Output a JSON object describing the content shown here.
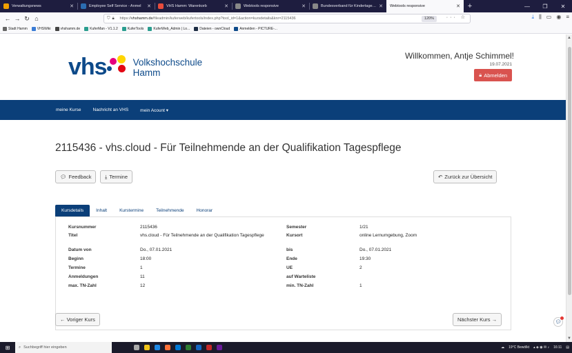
{
  "browser": {
    "tabs": [
      {
        "title": "Verwaltungsnews",
        "color": "#f0a000",
        "active": false
      },
      {
        "title": "Employee Self Service - Anmel",
        "color": "#2b6cb0",
        "active": false
      },
      {
        "title": "VHS Hamm: Warenkorb",
        "color": "#e74c3c",
        "active": false
      },
      {
        "title": "Webtools responsive",
        "color": "#888888",
        "active": false
      },
      {
        "title": "Bundesverband für Kindertagespfle",
        "color": "#888888",
        "active": false
      },
      {
        "title": "Webtools responsive",
        "color": "#888888",
        "active": true
      }
    ],
    "url_prefix": "https://",
    "url_host": "vhshamm.de",
    "url_path": "/fileadmin/kuferweb/kufertools/index.php?tool_id=1&action=kursdetails&knr=2115436",
    "zoom": "120%",
    "bookmarks": [
      {
        "label": "Stadt Hamm",
        "color": "#666666"
      },
      {
        "label": "VHSWiki",
        "color": "#3a7bd5"
      },
      {
        "label": "vhshamm.de",
        "color": "#444444"
      },
      {
        "label": "KuferMan - V1.1.2",
        "color": "#2a9d8f"
      },
      {
        "label": "KuferTools",
        "color": "#2a9d8f"
      },
      {
        "label": "KuferWeb_Admin | Lo...",
        "color": "#2a9d8f"
      },
      {
        "label": "Dateien - ownCloud",
        "color": "#1d2d44"
      },
      {
        "label": "Anmelden - PICTURE-...",
        "color": "#0d4a8a"
      }
    ]
  },
  "header": {
    "logo_word": "vhs",
    "logo_line1": "Volkshochschule",
    "logo_line2": "Hamm",
    "welcome": "Willkommen, Antje Schimmel!",
    "date": "19.07.2021",
    "logout_label": "Abmelden"
  },
  "nav": {
    "items": [
      "meine Kurse",
      "Nachricht an VHS",
      "mein Acount ▾"
    ]
  },
  "course": {
    "title": "2115436 - vhs.cloud - Für Teilnehmende an der Qualifikation Tagespflege"
  },
  "actions": {
    "feedback": "Feedback",
    "termine": "Termine",
    "back": "Zurück zur Übersicht",
    "prev": "← Voriger Kurs",
    "next": "Nächster Kurs →"
  },
  "tabs": [
    "Kursdetails",
    "Inhalt",
    "Kurstermine",
    "Teilnehmende",
    "Honorar"
  ],
  "details": {
    "rows": [
      {
        "l1": "Kursnummer",
        "v1": "2115436",
        "l2": "Semester",
        "v2": "1/21"
      },
      {
        "l1": "Titel",
        "v1": "vhs.cloud - Für Teilnehmende an der Qualifikation Tagespflege",
        "l2": "Kursort",
        "v2": "online Lernumgebung, Zoom"
      },
      {
        "l1": "Datum von",
        "v1": "Do., 07.01.2021",
        "l2": "bis",
        "v2": "Do., 07.01.2021"
      },
      {
        "l1": "Beginn",
        "v1": "18:00",
        "l2": "Ende",
        "v2": "19:30"
      },
      {
        "l1": "Termine",
        "v1": "1",
        "l2": "UE",
        "v2": "2"
      },
      {
        "l1": "Anmeldungen",
        "v1": "11",
        "l2": "auf Warteliste",
        "v2": ""
      },
      {
        "l1": "max. TN-Zahl",
        "v1": "12",
        "l2": "min. TN-Zahl",
        "v2": "1"
      }
    ]
  },
  "taskbar": {
    "search_placeholder": "Suchbegriff hier eingeben",
    "weather": "19°C Bewölkt",
    "time": "16:11"
  }
}
